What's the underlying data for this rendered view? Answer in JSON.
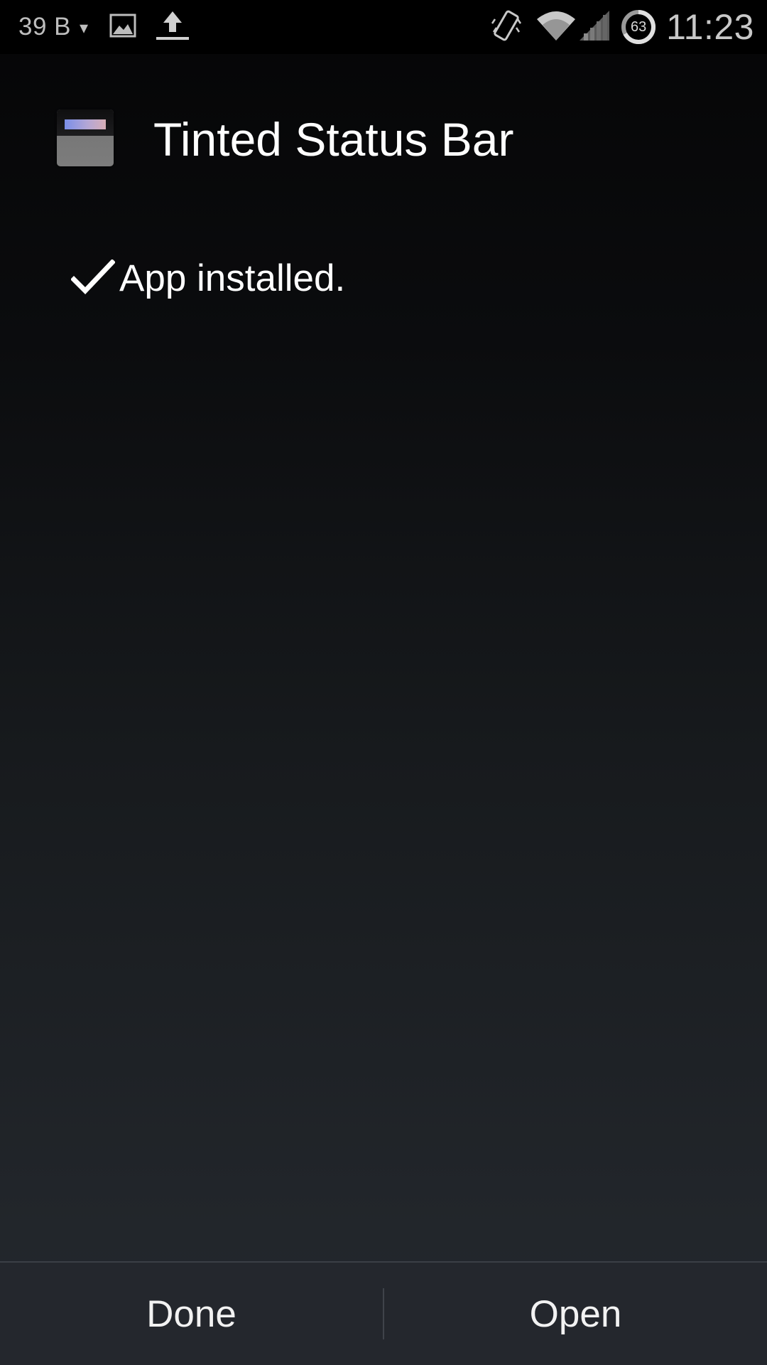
{
  "status_bar": {
    "data_usage": "39 B",
    "data_arrow": "▾",
    "notification_icons": [
      "image-icon",
      "upload-icon"
    ],
    "system_icons": [
      "vibrate-icon",
      "wifi-icon",
      "signal-icon"
    ],
    "battery_level": "63",
    "time": "11:23"
  },
  "header": {
    "app_icon": "tinted-status-bar-app-icon",
    "app_name": "Tinted Status Bar"
  },
  "message": {
    "icon": "checkmark-icon",
    "text": "App installed."
  },
  "buttons": {
    "done_label": "Done",
    "open_label": "Open"
  },
  "colors": {
    "background_top": "#050506",
    "background_bottom": "#24272d",
    "text": "#ffffff",
    "status_text": "#c8c8c8",
    "app_icon_tint": "#7a8ee8"
  }
}
